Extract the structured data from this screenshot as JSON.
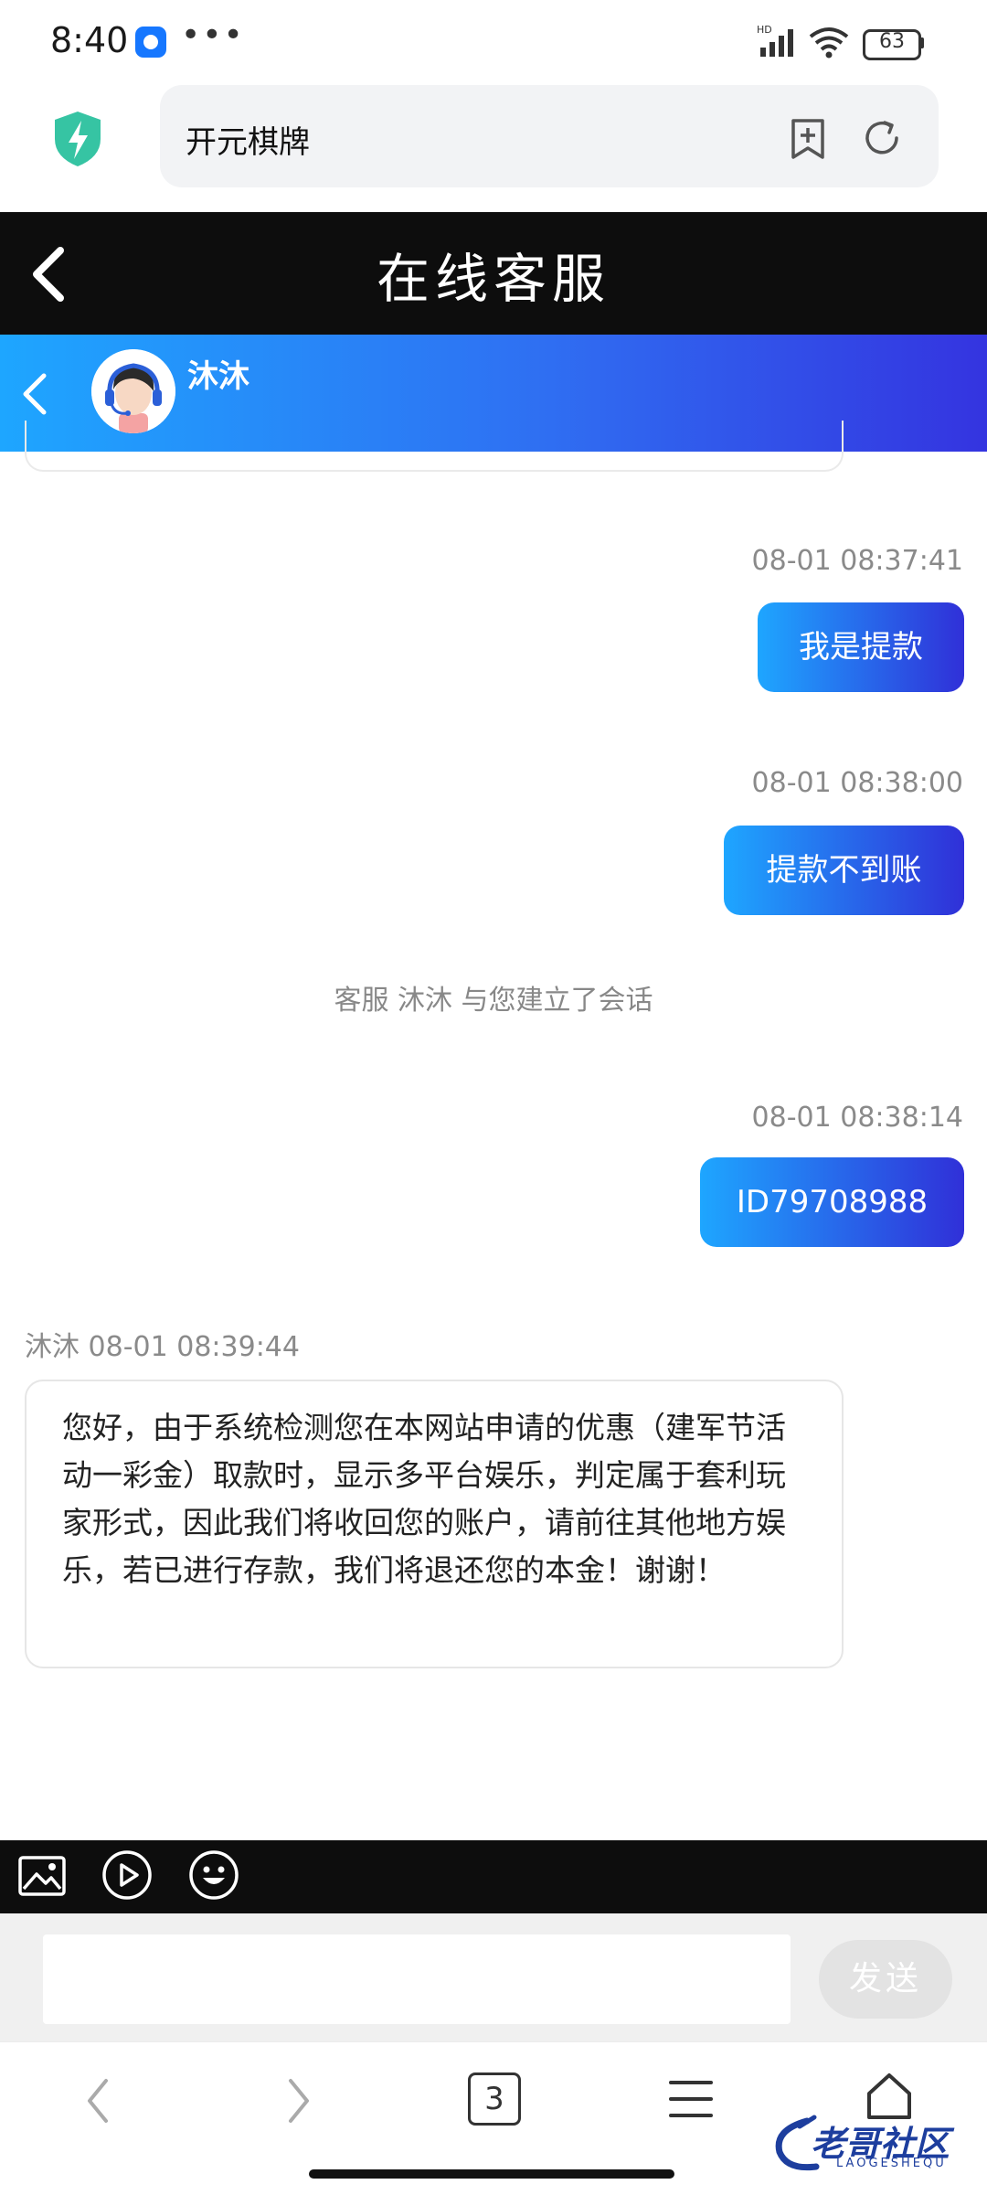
{
  "status_bar": {
    "time": "8:40",
    "more": "•••",
    "network": "HD",
    "battery": "63"
  },
  "browser": {
    "url_text": "开元棋牌"
  },
  "page_header": {
    "title": "在线客服"
  },
  "chat_header": {
    "agent_name": "沐沐"
  },
  "messages": [
    {
      "time": "08-01 08:37:41",
      "text": "我是提款"
    },
    {
      "time": "08-01 08:38:00",
      "text": "提款不到账"
    },
    {
      "time": "08-01 08:38:14",
      "text": "ID79708988"
    }
  ],
  "system_note": "客服 沐沐 与您建立了会话",
  "agent_message": {
    "header": "沐沐 08-01 08:39:44",
    "text": "您好，由于系统检测您在本网站申请的优惠（建军节活动一彩金）取款时，显示多平台娱乐，判定属于套利玩家形式，因此我们将收回您的账户，请前往其他地方娱乐，若已进行存款，我们将退还您的本金！谢谢！"
  },
  "composer": {
    "send_label": "发送",
    "placeholder": ""
  },
  "nav": {
    "tab_count": "3"
  },
  "watermark": {
    "text": "老哥社区",
    "sub": "LAOGESHEQU"
  },
  "colors": {
    "header_gradient_start": "#1ea6ff",
    "header_gradient_end": "#3434e0",
    "page_header_bg": "#0d0d0d"
  }
}
